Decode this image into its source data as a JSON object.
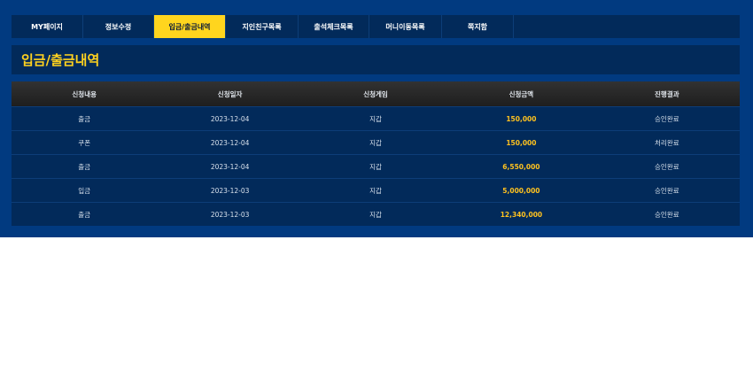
{
  "tabs": [
    {
      "label": "MY페이지",
      "active": false
    },
    {
      "label": "정보수정",
      "active": false
    },
    {
      "label": "입금/출금내역",
      "active": true
    },
    {
      "label": "지인친구목록",
      "active": false
    },
    {
      "label": "출석체크목록",
      "active": false
    },
    {
      "label": "머니이동목록",
      "active": false
    },
    {
      "label": "쪽지함",
      "active": false
    }
  ],
  "page_title": "입금/출금내역",
  "table": {
    "headers": [
      "신청내용",
      "신청일자",
      "신청게임",
      "신청금액",
      "진행결과"
    ],
    "rows": [
      {
        "type": "출금",
        "date": "2023-12-04",
        "game": "지갑",
        "amount": "150,000",
        "status": "승인완료"
      },
      {
        "type": "쿠폰",
        "date": "2023-12-04",
        "game": "지갑",
        "amount": "150,000",
        "status": "처리완료"
      },
      {
        "type": "출금",
        "date": "2023-12-04",
        "game": "지갑",
        "amount": "6,550,000",
        "status": "승인완료"
      },
      {
        "type": "입금",
        "date": "2023-12-03",
        "game": "지갑",
        "amount": "5,000,000",
        "status": "승인완료"
      },
      {
        "type": "출금",
        "date": "2023-12-03",
        "game": "지갑",
        "amount": "12,340,000",
        "status": "승인완료"
      }
    ]
  },
  "colors": {
    "background": "#013a80",
    "panel": "#022a5a",
    "accent": "#ffd51e",
    "amount": "#ffc21f"
  }
}
